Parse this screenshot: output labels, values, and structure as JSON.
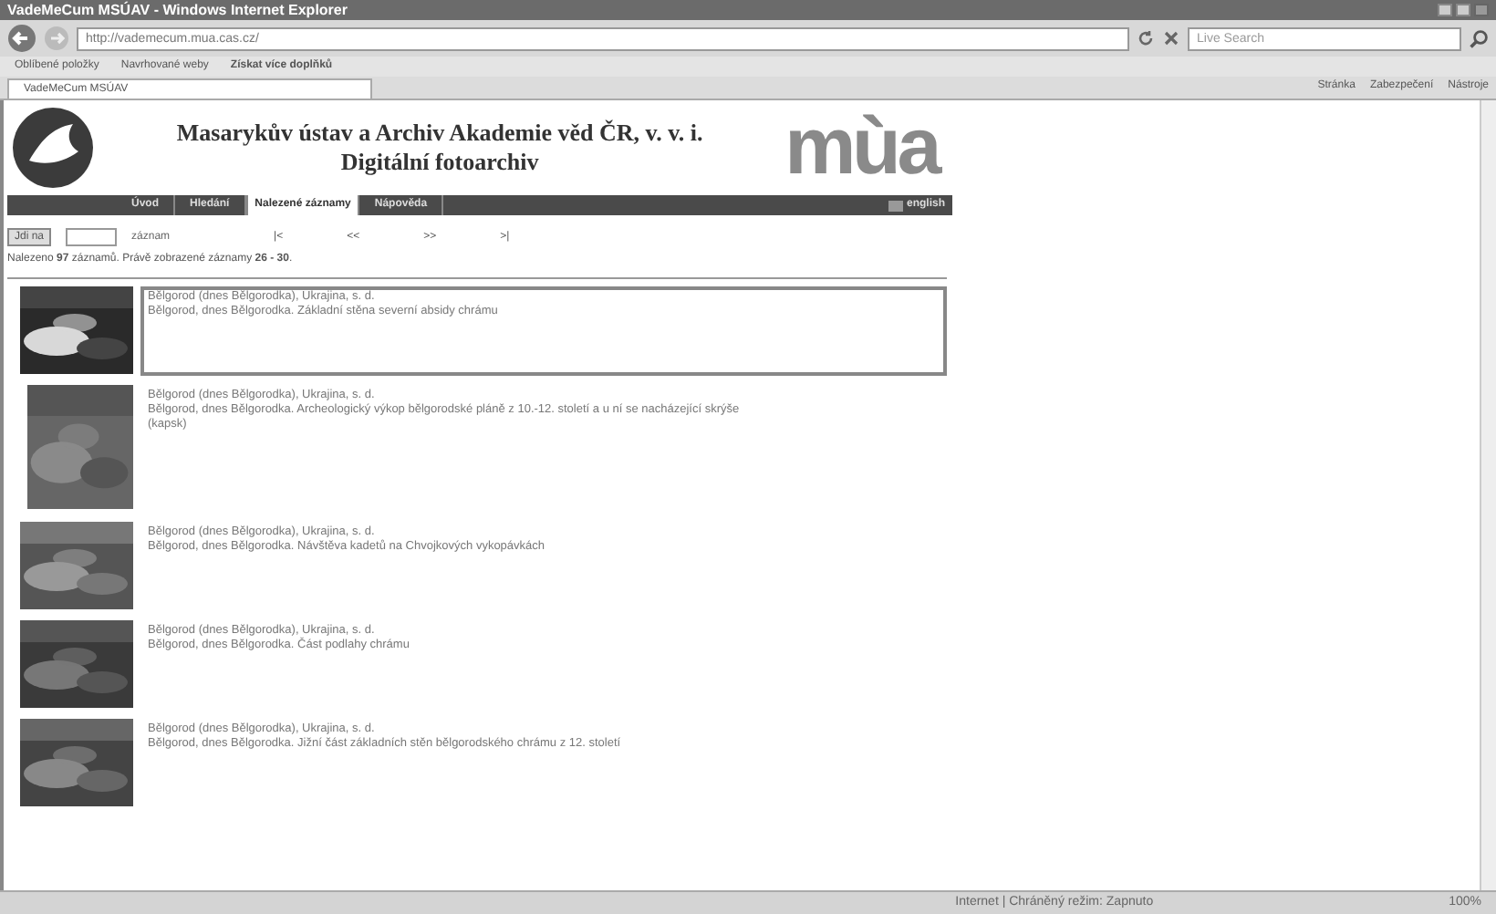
{
  "window": {
    "title": "VadeMeCum MSÚAV - Windows Internet Explorer"
  },
  "address_bar": {
    "value": "http://vademecum.mua.cas.cz/"
  },
  "search": {
    "placeholder": "Live Search"
  },
  "favorites_bar": {
    "items": [
      "Oblíbené položky",
      "Navrhované weby",
      "Získat více doplňků"
    ]
  },
  "tabs": [
    {
      "label": "VadeMeCum MSÚAV",
      "selected": true
    }
  ],
  "command_bar": [
    "Stránka",
    "Zabezpečení",
    "Nástroje"
  ],
  "header": {
    "title": "Masarykův ústav a Archiv Akademie věd ČR, v. v. i.",
    "subtitle": "Digitální fotoarchiv",
    "logo_text": "mùa"
  },
  "nav": [
    {
      "label": "Úvod",
      "selected": false
    },
    {
      "label": "Hledání",
      "selected": false
    },
    {
      "label": "Nalezené záznamy",
      "selected": true
    },
    {
      "label": "Nápověda",
      "selected": false
    }
  ],
  "language_link": "english",
  "pager": {
    "go_button": "Jdi na",
    "unit": "záznam",
    "links": [
      "|<",
      "<<",
      ">>",
      ">|"
    ]
  },
  "summary": "Nalezeno **97** záznamů. Právě zobrazené záznamy **26 - 30**.",
  "results": [
    {
      "title": "Bělgorod (dnes Bělgorodka), Ukrajina, s. d.",
      "description": "Bělgorod, dnes Bělgorodka. Základní stěna severní absidy chrámu",
      "selected": true
    },
    {
      "title": "Bělgorod (dnes Bělgorodka), Ukrajina, s. d.",
      "description": "Bělgorod, dnes Bělgorodka. Archeologický výkop bělgorodské pláně z 10.-12. století a u ní se nacházející skrýše (kapsk)",
      "selected": false
    },
    {
      "title": "Bělgorod (dnes Bělgorodka), Ukrajina, s. d.",
      "description": "Bělgorod, dnes Bělgorodka. Návštěva kadetů na Chvojkových vykopávkách",
      "selected": false
    },
    {
      "title": "Bělgorod (dnes Bělgorodka), Ukrajina, s. d.",
      "description": "Bělgorod, dnes Bělgorodka. Část podlahy chrámu",
      "selected": false
    },
    {
      "title": "Bělgorod (dnes Bělgorodka), Ukrajina, s. d.",
      "description": "Bělgorod, dnes Bělgorodka. Jižní část základních stěn bělgorodského chrámu z 12. století",
      "selected": false
    }
  ],
  "status_bar": {
    "zone": "Internet | Chráněný režim: Zapnuto",
    "zoom": "100%"
  }
}
